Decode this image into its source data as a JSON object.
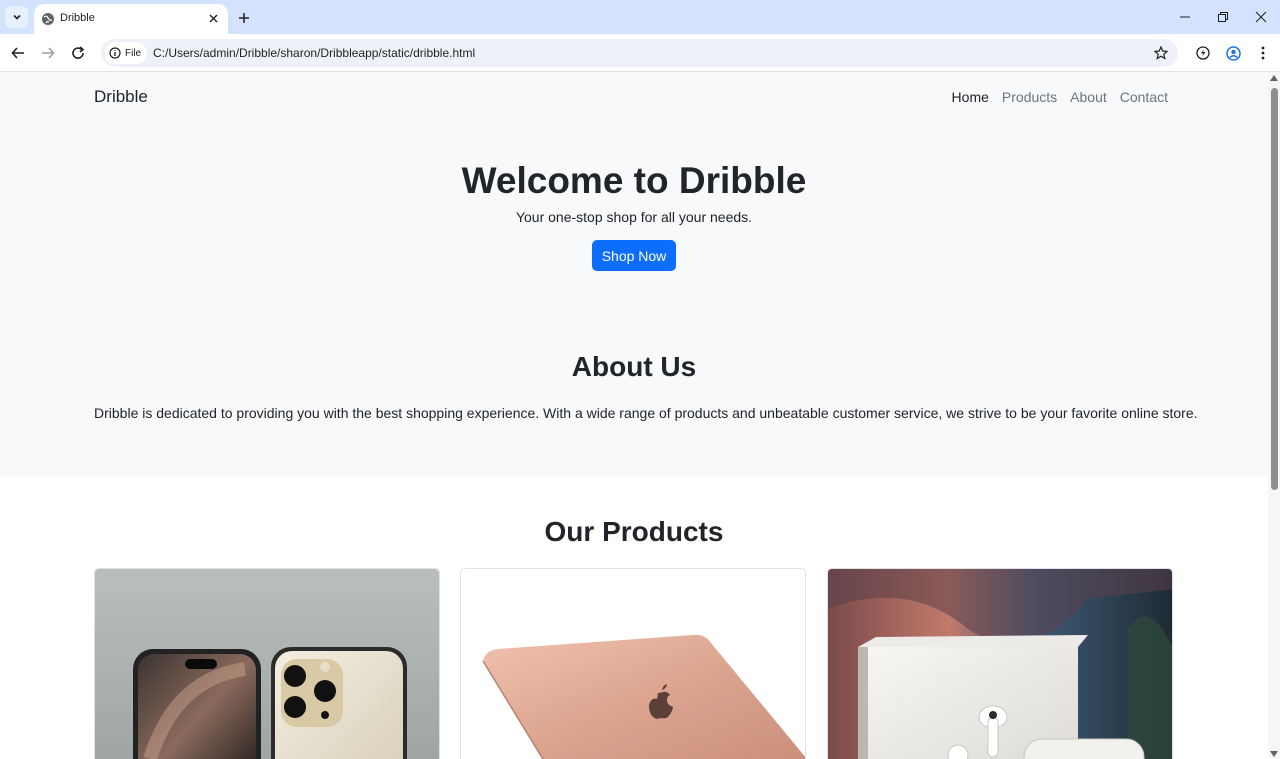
{
  "browser": {
    "tab_title": "Dribble",
    "omnibox_chip": "File",
    "url": "C:/Users/admin/Dribble/sharon/Dribbleapp/static/dribble.html"
  },
  "navbar": {
    "brand": "Dribble",
    "links": [
      "Home",
      "Products",
      "About",
      "Contact"
    ],
    "active": "Home"
  },
  "hero": {
    "title": "Welcome to Dribble",
    "subtitle": "Your one-stop shop for all your needs.",
    "cta_label": "Shop Now",
    "cta_color": "#0d6efd"
  },
  "about": {
    "title": "About Us",
    "text": "Dribble is dedicated to providing you with the best shopping experience. With a wide range of products and unbeatable customer service, we strive to be your favorite online store."
  },
  "products": {
    "title": "Our Products",
    "items": [
      {
        "image": "smartphones-photo"
      },
      {
        "image": "laptop-photo"
      },
      {
        "image": "earbuds-photo"
      }
    ]
  },
  "colors": {
    "light_bg": "#f8f9fa",
    "text": "#212529",
    "muted": "#6c757d"
  }
}
